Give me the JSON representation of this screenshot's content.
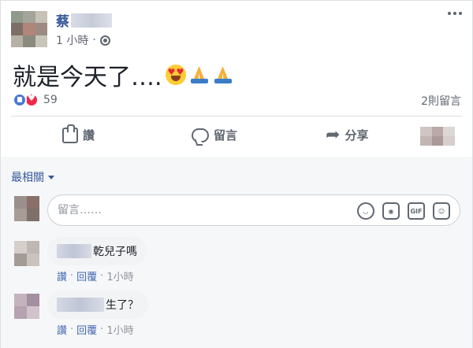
{
  "post": {
    "author_visible": "蔡",
    "time": "1 小時",
    "dot": "·",
    "text": "就是今天了….",
    "reaction_count": "59",
    "comment_count": "2則留言"
  },
  "actions": {
    "like": "讚",
    "comment": "留言",
    "share": "分享"
  },
  "comments_section": {
    "sort_label": "最相關",
    "input_placeholder": "留言……",
    "input_value": ""
  },
  "comments": [
    {
      "text": "乾兒子嗎",
      "like": "讚",
      "reply": "回覆",
      "time": "1小時",
      "sep": "·"
    },
    {
      "text": "生了？",
      "like": "讚",
      "reply": "回覆",
      "time": "1小時",
      "sep": "·"
    }
  ],
  "icons": {
    "globe": "globe-icon",
    "more": "more-options-icon",
    "like": "thumbs-up-icon",
    "comment": "speech-bubble-icon",
    "share": "share-arrow-icon",
    "emoji": "smiley-icon",
    "camera": "camera-icon",
    "gif": "gif-icon",
    "sticker": "sticker-icon"
  },
  "colors": {
    "link_blue": "#365899",
    "like_blue": "#4a78d6",
    "love_red": "#f0284a",
    "muted_text": "#616770"
  }
}
